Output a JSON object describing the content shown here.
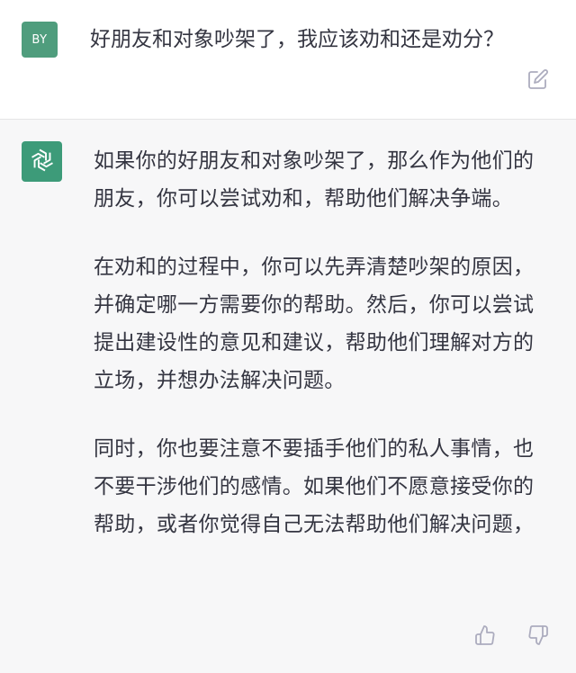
{
  "user": {
    "avatar_initials": "BY",
    "message": "好朋友和对象吵架了，我应该劝和还是劝分？"
  },
  "assistant": {
    "paragraphs": [
      "如果你的好朋友和对象吵架了，那么作为他们的朋友，你可以尝试劝和，帮助他们解决争端。",
      "在劝和的过程中，你可以先弄清楚吵架的原因，并确定哪一方需要你的帮助。然后，你可以尝试提出建设性的意见和建议，帮助他们理解对方的立场，并想办法解决问题。",
      "同时，你也要注意不要插手他们的私人事情，也不要干涉他们的感情。如果他们不愿意接受你的帮助，或者你觉得自己无法帮助他们解决问题，"
    ]
  },
  "icons": {
    "edit": "edit-icon",
    "assistant_logo": "openai-logo-icon",
    "thumbs_up": "thumbs-up-icon",
    "thumbs_down": "thumbs-down-icon"
  },
  "colors": {
    "user_avatar": "#4f9d7d",
    "assistant_avatar": "#3d9b79",
    "assistant_bg": "#f7f7f8",
    "text": "#343541",
    "icon": "#acacbe"
  }
}
